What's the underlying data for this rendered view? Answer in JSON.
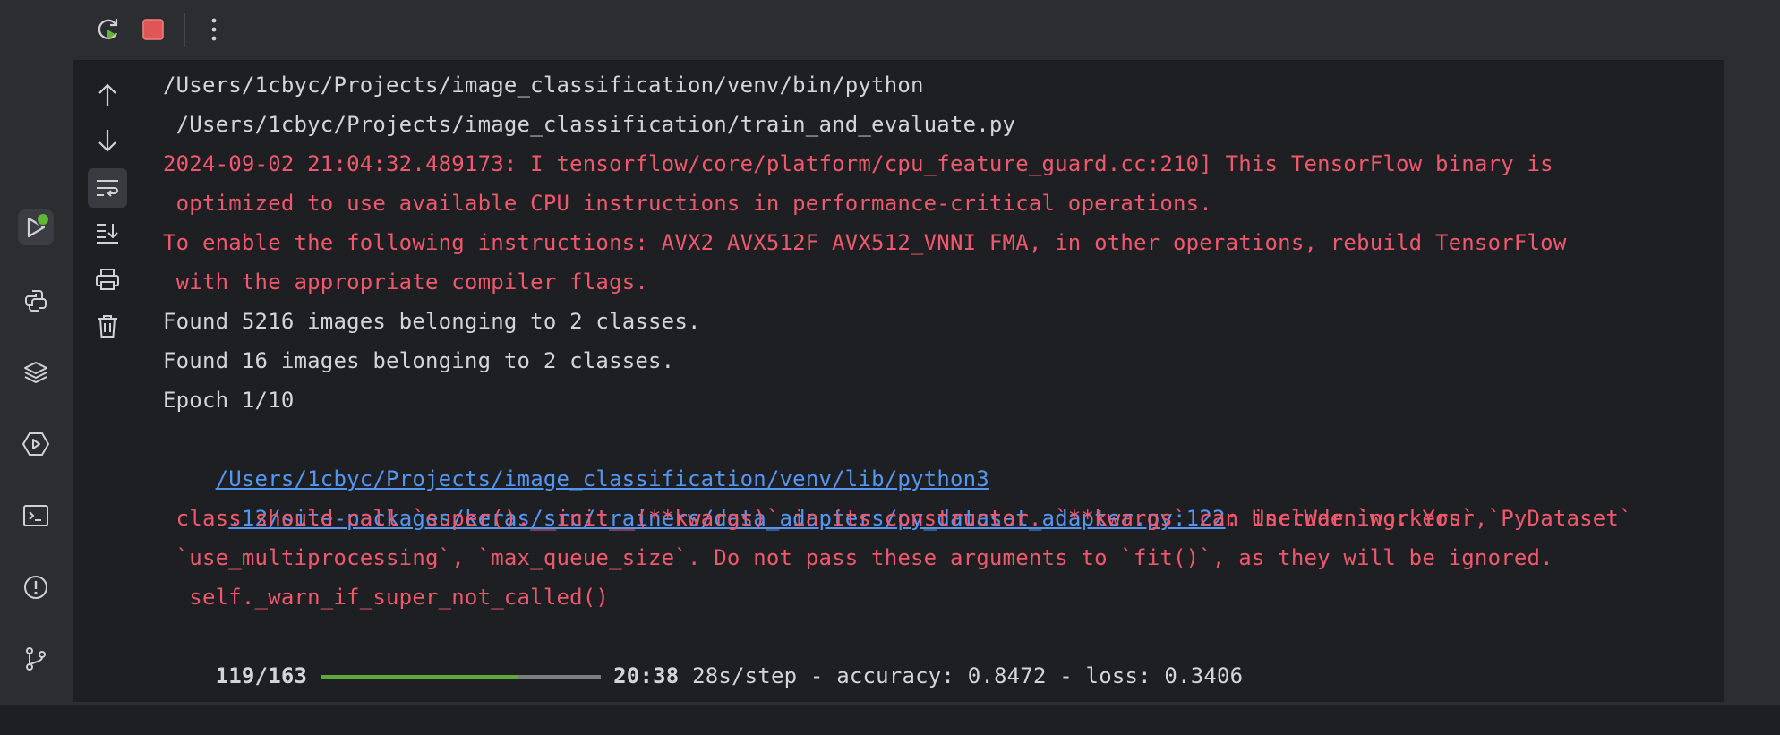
{
  "toolbar": {
    "rerun": "rerun-icon",
    "stop": "stop-icon",
    "more": "more-vertical-icon"
  },
  "left_sidebar": [
    {
      "name": "run-icon",
      "active": true
    },
    {
      "name": "python-console-icon"
    },
    {
      "name": "python-packages-icon"
    },
    {
      "name": "services-icon"
    },
    {
      "name": "terminal-icon"
    },
    {
      "name": "problems-icon"
    },
    {
      "name": "git-icon"
    }
  ],
  "console_tools": [
    {
      "name": "scroll-up-icon"
    },
    {
      "name": "scroll-down-icon"
    },
    {
      "name": "soft-wrap-icon",
      "active": true
    },
    {
      "name": "scroll-to-end-icon"
    },
    {
      "name": "print-icon"
    },
    {
      "name": "clear-all-icon"
    }
  ],
  "console": {
    "line1": "/Users/1cbyc/Projects/image_classification/venv/bin/python",
    "line2": " /Users/1cbyc/Projects/image_classification/train_and_evaluate.py",
    "line3": "2024-09-02 21:04:32.489173: I tensorflow/core/platform/cpu_feature_guard.cc:210] This TensorFlow binary is",
    "line4": " optimized to use available CPU instructions in performance-critical operations.",
    "line5": "To enable the following instructions: AVX2 AVX512F AVX512_VNNI FMA, in other operations, rebuild TensorFlow",
    "line6": " with the appropriate compiler flags.",
    "line7": "Found 5216 images belonging to 2 classes.",
    "line8": "Found 16 images belonging to 2 classes.",
    "line9": "Epoch 1/10",
    "line10_link": "/Users/1cbyc/Projects/image_classification/venv/lib/python3",
    "line11_link": ".12/site-packages/keras/src/trainers/data_adapters/py_dataset_adapter.py:122",
    "line11_rest": ": UserWarning: Your `PyDataset`",
    "line12": " class should call `super().__init__(**kwargs)` in its constructor. `**kwargs` can include `workers`,",
    "line13": " `use_multiprocessing`, `max_queue_size`. Do not pass these arguments to `fit()`, as they will be ignored.",
    "line14": "  self._warn_if_super_not_called()",
    "progress_count": "119/163",
    "progress_fraction": 0.7,
    "progress_eta": "20:38",
    "progress_rest": "28s/step - accuracy: 0.8472 - loss: 0.3406"
  },
  "colors": {
    "error": "#f0596d",
    "link": "#5596f2",
    "text": "#d3d5d9",
    "progress_fill": "#5fa83a"
  }
}
